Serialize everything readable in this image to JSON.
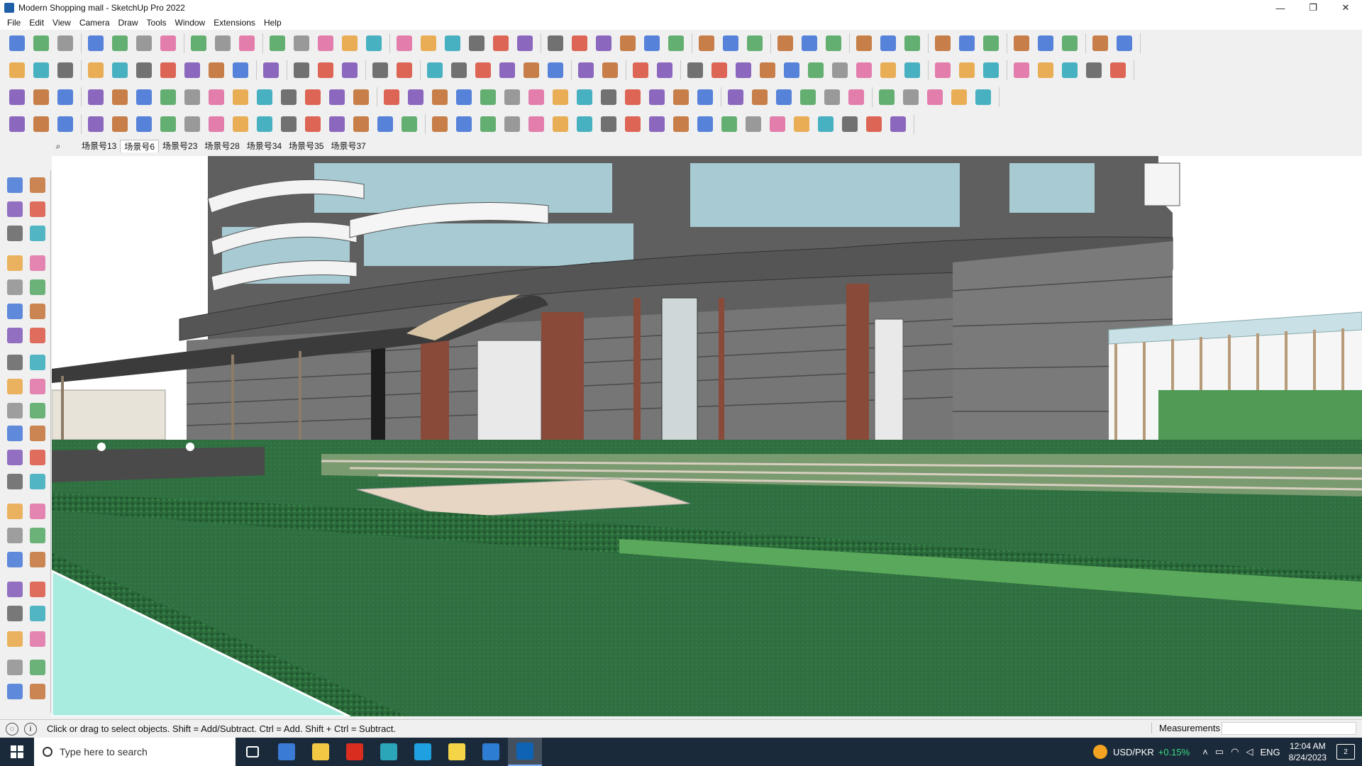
{
  "window": {
    "title": "Modern Shopping mall - SketchUp Pro 2022",
    "minimize_glyph": "—",
    "maximize_glyph": "❐",
    "close_glyph": "✕"
  },
  "menu": [
    "File",
    "Edit",
    "View",
    "Camera",
    "Draw",
    "Tools",
    "Window",
    "Extensions",
    "Help"
  ],
  "scenes": {
    "search_glyph": "⌕",
    "tabs": [
      "场景号13",
      "场景号6",
      "场景号23",
      "场景号28",
      "场景号34",
      "场景号35",
      "场景号37"
    ],
    "active_index": 1
  },
  "status": {
    "info_glyph": "i",
    "hint": "Click or drag to select objects. Shift = Add/Subtract. Ctrl = Add. Shift + Ctrl = Subtract.",
    "measurements_label": "Measurements",
    "measurements_value": ""
  },
  "taskbar": {
    "search_placeholder": "Type here to search",
    "stock_pair": "USD/PKR",
    "stock_change": "+0.15%",
    "language": "ENG",
    "time": "12:04 AM",
    "date": "8/24/2023",
    "notifications": "2",
    "apps": [
      {
        "name": "task-view-icon",
        "color": "#ffffff"
      },
      {
        "name": "calculator-icon",
        "color": "#3a7bd5"
      },
      {
        "name": "file-explorer-icon",
        "color": "#f2c744"
      },
      {
        "name": "acrobat-icon",
        "color": "#d92d20"
      },
      {
        "name": "3dsmax-icon",
        "color": "#2aa6b8"
      },
      {
        "name": "edge-icon",
        "color": "#1fa0e0"
      },
      {
        "name": "sticky-notes-icon",
        "color": "#f5d547"
      },
      {
        "name": "photos-icon",
        "color": "#2d7dd2"
      },
      {
        "name": "sketchup-icon",
        "color": "#0e63b5"
      }
    ]
  },
  "colors": {
    "grass_dark": "#2c6a3c",
    "grass_light": "#4f9a55",
    "water": "#a8ece0",
    "building_gray": "#6f6f6f",
    "glass": "#a7cad3",
    "column_brown": "#8a4a3a"
  }
}
